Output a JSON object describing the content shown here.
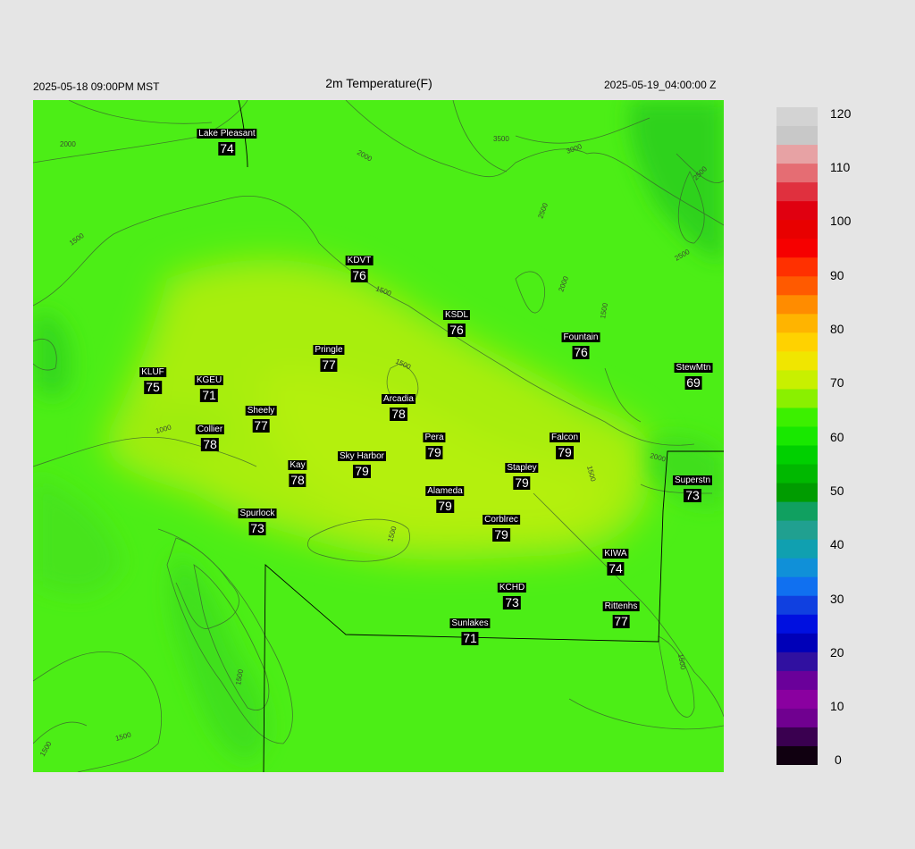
{
  "header": {
    "left": "2025-05-18 09:00PM MST",
    "title": "2m Temperature(F)",
    "right": "2025-05-19_04:00:00 Z"
  },
  "map": {
    "contour_labels": [
      "2000",
      "2000",
      "3500",
      "3000",
      "2500",
      "2500",
      "1500",
      "1500",
      "2000",
      "2500",
      "1500",
      "1500",
      "1000",
      "1500",
      "2000",
      "1500",
      "1500",
      "1500",
      "1500",
      "1500"
    ],
    "stations": [
      {
        "name": "Lake Pleasant",
        "value": "74"
      },
      {
        "name": "KDVT",
        "value": "76"
      },
      {
        "name": "KSDL",
        "value": "76"
      },
      {
        "name": "Fountain",
        "value": "76"
      },
      {
        "name": "StewMtn",
        "value": "69"
      },
      {
        "name": "Pringle",
        "value": "77"
      },
      {
        "name": "KLUF",
        "value": "75"
      },
      {
        "name": "KGEU",
        "value": "71"
      },
      {
        "name": "Arcadia",
        "value": "78"
      },
      {
        "name": "Sheely",
        "value": "77"
      },
      {
        "name": "Collier",
        "value": "78"
      },
      {
        "name": "Pera",
        "value": "79"
      },
      {
        "name": "Falcon",
        "value": "79"
      },
      {
        "name": "Sky Harbor",
        "value": "79"
      },
      {
        "name": "Kay",
        "value": "78"
      },
      {
        "name": "Stapley",
        "value": "79"
      },
      {
        "name": "Superstn",
        "value": "73"
      },
      {
        "name": "Alameda",
        "value": "79"
      },
      {
        "name": "Spurlock",
        "value": "73"
      },
      {
        "name": "Corblrec",
        "value": "79"
      },
      {
        "name": "KIWA",
        "value": "74"
      },
      {
        "name": "KCHD",
        "value": "73"
      },
      {
        "name": "Rittenhs",
        "value": "77"
      },
      {
        "name": "Sunlakes",
        "value": "71"
      }
    ]
  },
  "colorbar": {
    "ticks": [
      "120",
      "110",
      "100",
      "90",
      "80",
      "70",
      "60",
      "50",
      "40",
      "30",
      "20",
      "10",
      "0"
    ],
    "colors": [
      "#d3d3d3",
      "#c8c8c8",
      "#e7a2a4",
      "#e56d73",
      "#e0303e",
      "#e00010",
      "#e80000",
      "#f60000",
      "#ff3000",
      "#ff5a00",
      "#ff8c00",
      "#ffb400",
      "#ffd200",
      "#f0e600",
      "#c8f000",
      "#8af000",
      "#3cf000",
      "#18e800",
      "#00d000",
      "#00b800",
      "#009c00",
      "#10a060",
      "#20a090",
      "#10a0b0",
      "#1090d8",
      "#1070f0",
      "#1040e0",
      "#0010e0",
      "#0000b8",
      "#3010a0",
      "#6a009a",
      "#8a00a0",
      "#700090",
      "#3a0050",
      "#100010"
    ]
  }
}
